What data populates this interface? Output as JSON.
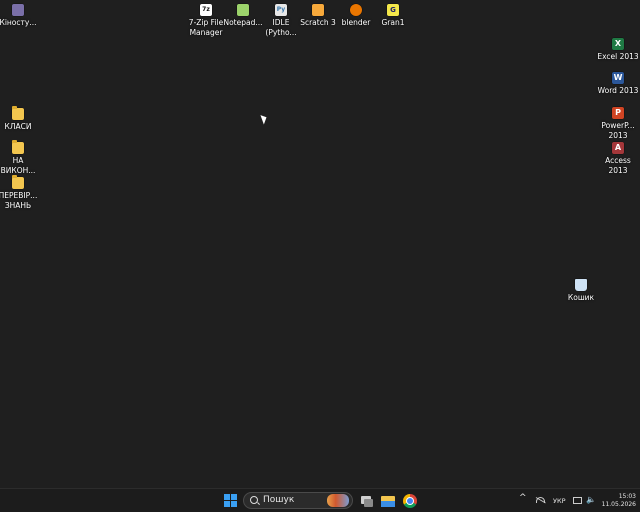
{
  "desktop": {
    "icons": [
      {
        "label": "Кіносту..."
      },
      {
        "label": "7-Zip File Manager"
      },
      {
        "label": "Notepad..."
      },
      {
        "label": "IDLE (Pytho..."
      },
      {
        "label": "Scratch 3"
      },
      {
        "label": "blender"
      },
      {
        "label": "Gran1"
      },
      {
        "label": "Excel 2013"
      },
      {
        "label": "Word 2013"
      },
      {
        "label": "PowerP... 2013"
      },
      {
        "label": "Access 2013"
      },
      {
        "label": "КЛАСИ"
      },
      {
        "label": "НА ВИКОН..."
      },
      {
        "label": "ПЕРЕВІР... ЗНАНЬ"
      },
      {
        "label": "Кошик"
      }
    ]
  },
  "taskbar": {
    "search_placeholder": "Пошук",
    "language": "УКР",
    "time": "15:03",
    "date": "11.05.2026",
    "tray_chevron": "^"
  },
  "colors": {
    "desktop_bg": "#1f1f1f",
    "taskbar_bg": "#1c1c1c",
    "start_blue": "#3aa0f3",
    "folder_yellow": "#f3c64f"
  }
}
